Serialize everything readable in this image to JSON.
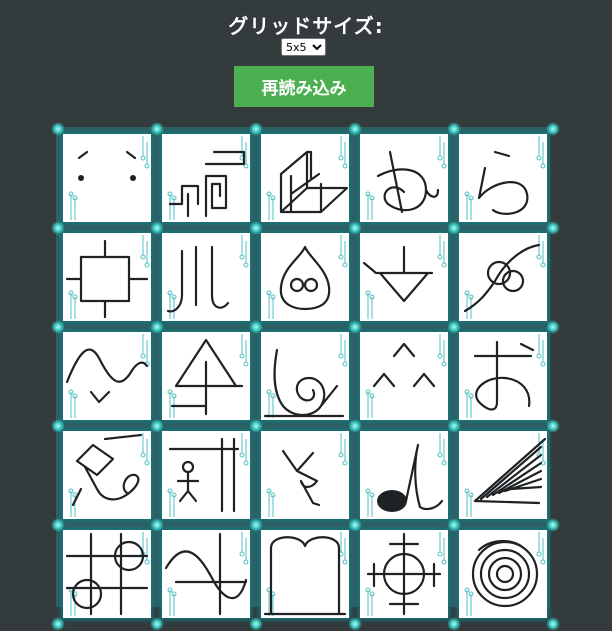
{
  "header": {
    "title": "グリッドサイズ:",
    "grid_size_options": [
      "5x5"
    ],
    "grid_size_selected": "5x5",
    "reload_label": "再読み込み"
  },
  "colors": {
    "background": "#343b3d",
    "button": "#4caf50",
    "tile": "#ffffff",
    "board": "#2f5f63",
    "glow": "#38c9c0",
    "circuit_accent": "#52bfc2"
  },
  "tiles": [
    {
      "row": 1,
      "col": 1,
      "glyph": "face"
    },
    {
      "row": 1,
      "col": 2,
      "glyph": "maze-lines"
    },
    {
      "row": 1,
      "col": 3,
      "glyph": "box-3d"
    },
    {
      "row": 1,
      "col": 4,
      "glyph": "kana-me"
    },
    {
      "row": 1,
      "col": 5,
      "glyph": "kana-ra"
    },
    {
      "row": 2,
      "col": 1,
      "glyph": "box-cross"
    },
    {
      "row": 2,
      "col": 2,
      "glyph": "kana-ru"
    },
    {
      "row": 2,
      "col": 3,
      "glyph": "slime"
    },
    {
      "row": 2,
      "col": 4,
      "glyph": "ground-symbol"
    },
    {
      "row": 2,
      "col": 5,
      "glyph": "circles-curve"
    },
    {
      "row": 3,
      "col": 1,
      "glyph": "wave-check"
    },
    {
      "row": 3,
      "col": 2,
      "glyph": "triangle-cross"
    },
    {
      "row": 3,
      "col": 3,
      "glyph": "spiral-six"
    },
    {
      "row": 3,
      "col": 4,
      "glyph": "carets"
    },
    {
      "row": 3,
      "col": 5,
      "glyph": "kana-o"
    },
    {
      "row": 4,
      "col": 1,
      "glyph": "diamond-scribble"
    },
    {
      "row": 4,
      "col": 2,
      "glyph": "stick-figure"
    },
    {
      "row": 4,
      "col": 3,
      "glyph": "scribble"
    },
    {
      "row": 4,
      "col": 4,
      "glyph": "music-note"
    },
    {
      "row": 4,
      "col": 5,
      "glyph": "fan"
    },
    {
      "row": 5,
      "col": 1,
      "glyph": "circle-lattice"
    },
    {
      "row": 5,
      "col": 2,
      "glyph": "s-curve"
    },
    {
      "row": 5,
      "col": 3,
      "glyph": "arch-frame"
    },
    {
      "row": 5,
      "col": 4,
      "glyph": "crosshair"
    },
    {
      "row": 5,
      "col": 5,
      "glyph": "concentric-circles"
    }
  ]
}
